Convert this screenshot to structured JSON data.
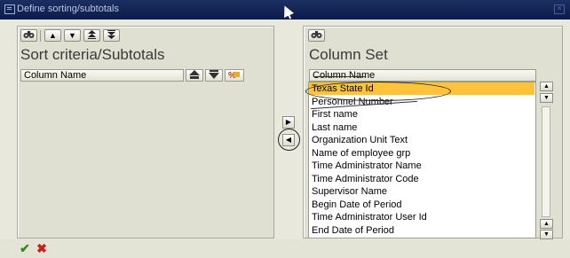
{
  "window": {
    "title": "Define sorting/subtotals",
    "window_icon": "window-menu-icon",
    "close_icon": "close-icon"
  },
  "left_panel": {
    "title": "Sort criteria/Subtotals",
    "toolbar": {
      "find_icon": "binoculars-icon",
      "buttons": [
        {
          "icon": "move-up-icon",
          "glyph": "▲"
        },
        {
          "icon": "move-down-icon",
          "glyph": "▼"
        },
        {
          "icon": "move-top-icon",
          "glyph": "⇞"
        },
        {
          "icon": "move-bottom-icon",
          "glyph": "⇟"
        }
      ]
    },
    "column_header": "Column Name",
    "header_icons": [
      "sort-ascending-icon",
      "sort-descending-icon",
      "subtotal-icon"
    ],
    "rows": []
  },
  "right_panel": {
    "title": "Column Set",
    "toolbar": {
      "find_icon": "binoculars-icon"
    },
    "column_header": "Column Name",
    "rows": [
      {
        "label": "Texas State Id",
        "selected": true
      },
      {
        "label": "Personnel Number",
        "selected": false
      },
      {
        "label": "First name",
        "selected": false
      },
      {
        "label": "Last name",
        "selected": false
      },
      {
        "label": "Organization Unit Text",
        "selected": false
      },
      {
        "label": "Name of employee grp",
        "selected": false
      },
      {
        "label": "Time Administrator Name",
        "selected": false
      },
      {
        "label": "Time Administrator Code",
        "selected": false
      },
      {
        "label": "Supervisor Name",
        "selected": false
      },
      {
        "label": "Begin Date of Period",
        "selected": false
      },
      {
        "label": "Time Administrator User Id",
        "selected": false
      },
      {
        "label": "End Date of Period",
        "selected": false
      }
    ]
  },
  "transfer": {
    "add_icon": "arrow-right-icon",
    "remove_icon": "arrow-left-icon"
  },
  "footer": {
    "confirm_icon": "checkmark-icon",
    "cancel_icon": "cancel-x-icon"
  },
  "colors": {
    "selection": "#ffc33a",
    "title_bar": "#1b2f63",
    "confirm": "#2e8b1e",
    "cancel": "#cc1b1b"
  }
}
